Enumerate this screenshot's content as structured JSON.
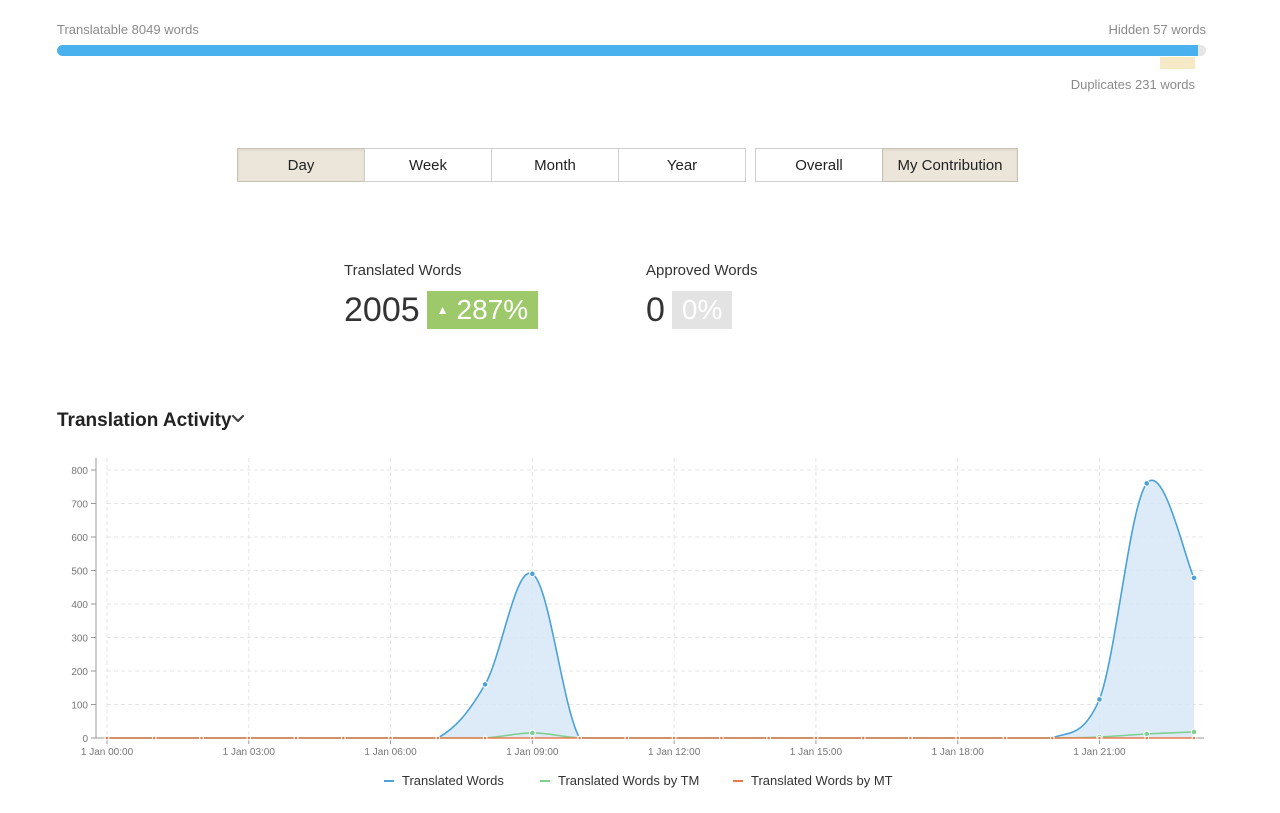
{
  "progress": {
    "translatable_label": "Translatable 8049 words",
    "hidden_label": "Hidden 57 words",
    "duplicates_label": "Duplicates 231 words",
    "translatable_fraction": 0.993,
    "bar_color": "#49b1ee"
  },
  "period_buttons": [
    {
      "label": "Day",
      "active": true
    },
    {
      "label": "Week",
      "active": false
    },
    {
      "label": "Month",
      "active": false
    },
    {
      "label": "Year",
      "active": false
    }
  ],
  "scope_buttons": [
    {
      "label": "Overall",
      "active": false
    },
    {
      "label": "My Contribution",
      "active": true
    }
  ],
  "stats": {
    "translated": {
      "label": "Translated Words",
      "value": "2005",
      "change": "287%",
      "trend_icon": "▲"
    },
    "approved": {
      "label": "Approved Words",
      "value": "0",
      "change": "0%"
    }
  },
  "section": {
    "title": "Translation Activity",
    "chevron_icon": "chevron-down-icon"
  },
  "chart_data": {
    "type": "area",
    "title": "",
    "xlabel": "",
    "ylabel": "",
    "ylim": [
      0,
      800
    ],
    "yticks": [
      0,
      100,
      200,
      300,
      400,
      500,
      600,
      700,
      800
    ],
    "x": [
      "1 Jan 00:00",
      "1 Jan 01:00",
      "1 Jan 02:00",
      "1 Jan 03:00",
      "1 Jan 04:00",
      "1 Jan 05:00",
      "1 Jan 06:00",
      "1 Jan 07:00",
      "1 Jan 08:00",
      "1 Jan 09:00",
      "1 Jan 10:00",
      "1 Jan 11:00",
      "1 Jan 12:00",
      "1 Jan 13:00",
      "1 Jan 14:00",
      "1 Jan 15:00",
      "1 Jan 16:00",
      "1 Jan 17:00",
      "1 Jan 18:00",
      "1 Jan 19:00",
      "1 Jan 20:00",
      "1 Jan 21:00",
      "1 Jan 22:00",
      "1 Jan 23:00"
    ],
    "tick_labels": [
      "1 Jan 00:00",
      "1 Jan 03:00",
      "1 Jan 06:00",
      "1 Jan 09:00",
      "1 Jan 12:00",
      "1 Jan 15:00",
      "1 Jan 18:00",
      "1 Jan 21:00"
    ],
    "grid": true,
    "legend_position": "bottom",
    "series": [
      {
        "name": "Translated Words",
        "color": "#4aa2d8",
        "fill": "#d6e8f6",
        "values": [
          0,
          0,
          0,
          0,
          0,
          0,
          0,
          0,
          160,
          490,
          0,
          0,
          0,
          0,
          0,
          0,
          0,
          0,
          0,
          0,
          0,
          115,
          760,
          478
        ]
      },
      {
        "name": "Translated Words by TM",
        "color": "#7fcf92",
        "values": [
          0,
          0,
          0,
          0,
          0,
          0,
          0,
          0,
          0,
          15,
          0,
          0,
          0,
          0,
          0,
          0,
          0,
          0,
          0,
          0,
          0,
          3,
          12,
          18
        ]
      },
      {
        "name": "Translated Words by MT",
        "color": "#e87b4d",
        "values": [
          0,
          0,
          0,
          0,
          0,
          0,
          0,
          0,
          0,
          0,
          0,
          0,
          0,
          0,
          0,
          0,
          0,
          0,
          0,
          0,
          0,
          0,
          0,
          0
        ]
      }
    ]
  }
}
